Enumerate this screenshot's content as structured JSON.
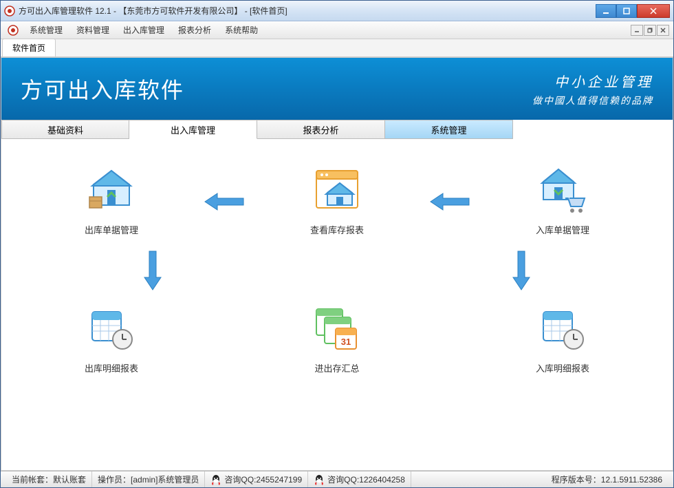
{
  "titlebar": {
    "title": "方可出入库管理软件 12.1 -  【东莞市方可软件开发有限公司】  - [软件首页]"
  },
  "menubar": {
    "items": [
      "系统管理",
      "资料管理",
      "出入库管理",
      "报表分析",
      "系统帮助"
    ]
  },
  "doctab": {
    "label": "软件首页"
  },
  "banner": {
    "title": "方可出入库软件",
    "sub1": "中小企业管理",
    "sub2": "做中國人值得信赖的品牌"
  },
  "navtabs": {
    "items": [
      "基础资料",
      "出入库管理",
      "报表分析",
      "系统管理"
    ],
    "active_index": 1
  },
  "features_row1": {
    "left": "出库单据管理",
    "mid": "查看库存报表",
    "right": "入库单据管理"
  },
  "features_row2": {
    "left": "出库明细报表",
    "mid": "进出存汇总",
    "right": "入库明细报表"
  },
  "statusbar": {
    "account_label": "当前帐套：",
    "account_value": "默认账套",
    "operator_label": "操作员：",
    "operator_value": "[admin]系统管理员",
    "qq1_label": "咨询QQ:2455247199",
    "qq2_label": "咨询QQ:1226404258",
    "version_label": "程序版本号：",
    "version_value": "12.1.5911.52386"
  }
}
